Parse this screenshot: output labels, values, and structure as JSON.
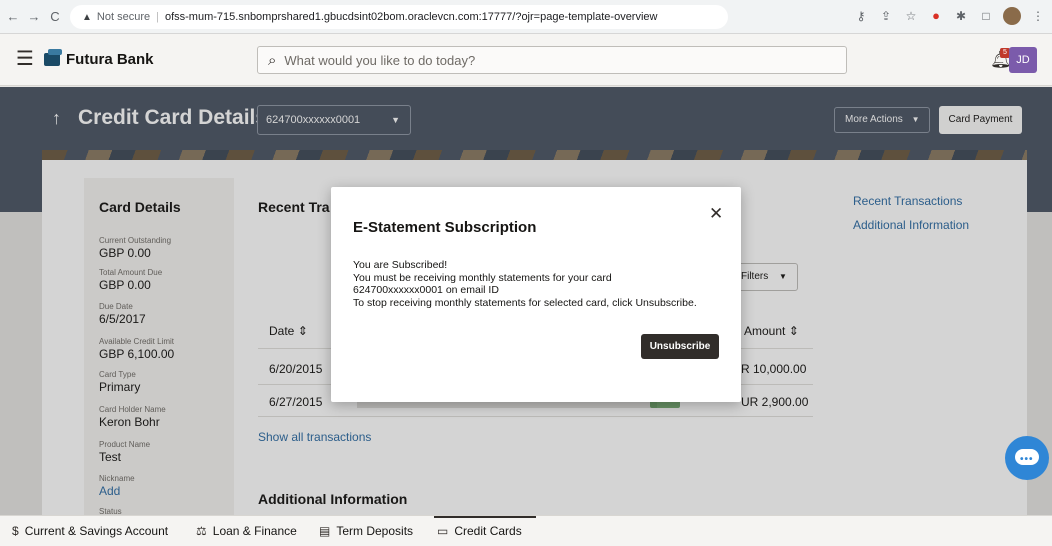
{
  "browser": {
    "security_label": "Not secure",
    "url": "ofss-mum-715.snbomprshared1.gbucdsint02bom.oraclevcn.com:17777/?ojr=page-template-overview"
  },
  "header": {
    "bank_name": "Futura Bank",
    "search_placeholder": "What would you like to do today?",
    "notification_count": "5",
    "user_initials": "JD"
  },
  "title_bar": {
    "back_symbol": "↑",
    "title": "Credit Card Details",
    "selected_card": "624700xxxxxx0001",
    "more_actions_label": "More Actions",
    "card_payment_label": "Card Payment"
  },
  "card_details": {
    "heading": "Card Details",
    "fields": [
      {
        "label": "Current Outstanding",
        "value": "GBP 0.00"
      },
      {
        "label": "Total Amount Due",
        "value": "GBP 0.00"
      },
      {
        "label": "Due Date",
        "value": "6/5/2017"
      },
      {
        "label": "Available Credit Limit",
        "value": "GBP 6,100.00"
      },
      {
        "label": "Card Type",
        "value": "Primary"
      },
      {
        "label": "Card Holder Name",
        "value": "Keron Bohr"
      },
      {
        "label": "Product Name",
        "value": "Test"
      },
      {
        "label": "Nickname",
        "value": "Add"
      },
      {
        "label": "Status",
        "value": ""
      }
    ]
  },
  "transactions": {
    "heading": "Recent Tra",
    "filters_label": "Filters",
    "col_date": "Date",
    "col_amount": "Amount",
    "rows": [
      {
        "date": "6/20/2015",
        "amount": "R 10,000.00"
      },
      {
        "date": "6/27/2015",
        "amount": "UR 2,900.00"
      }
    ],
    "show_all": "Show all transactions"
  },
  "additional_heading": "Additional Information",
  "right_links": [
    "Recent Transactions",
    "Additional Information"
  ],
  "modal": {
    "title": "E-Statement Subscription",
    "line1": "You are Subscribed!",
    "line2": "You must be receiving monthly statements for your card",
    "line3": "624700xxxxxx0001 on email ID",
    "line4": "To stop receiving monthly statements for selected card, click Unsubscribe.",
    "button": "Unsubscribe"
  },
  "bottom_nav": {
    "items": [
      {
        "label": "Current & Savings Account",
        "icon": "dollar-circle-icon"
      },
      {
        "label": "Loan & Finance",
        "icon": "loan-icon"
      },
      {
        "label": "Term Deposits",
        "icon": "deposit-icon"
      },
      {
        "label": "Credit Cards",
        "icon": "credit-card-icon"
      }
    ]
  }
}
